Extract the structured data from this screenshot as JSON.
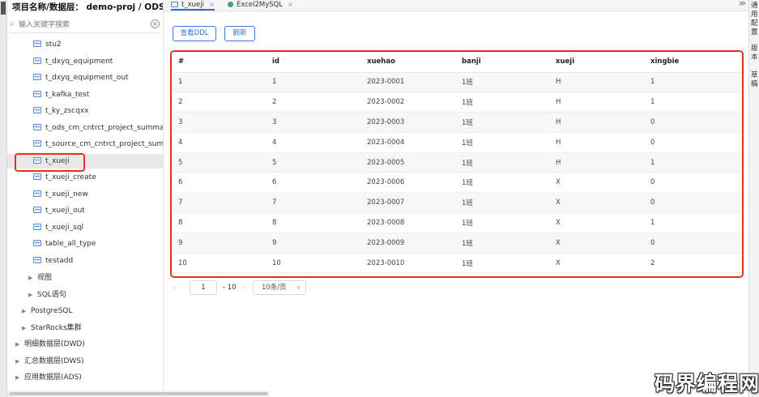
{
  "sidebar": {
    "title": "项目名称/数据层： demo-proj / ODS",
    "search_placeholder": "输入关键字搜索",
    "tables": [
      {
        "label": "stu2",
        "name": "table-item-stu2"
      },
      {
        "label": "t_dxyq_equipment",
        "name": "table-item-t-dxyq-equipment"
      },
      {
        "label": "t_dxyq_equipment_out",
        "name": "table-item-t-dxyq-equipment-out"
      },
      {
        "label": "t_kafka_test",
        "name": "table-item-t-kafka-test"
      },
      {
        "label": "t_ky_zscqxx",
        "name": "table-item-t-ky-zscqxx"
      },
      {
        "label": "t_ods_cm_cntrct_project_summary",
        "name": "table-item-t-ods-cm-cntrct-project-summary"
      },
      {
        "label": "t_source_cm_cntrct_project_summary",
        "name": "table-item-t-source-cm-cntrct-project-summary"
      },
      {
        "label": "t_xueji",
        "name": "table-item-t-xueji"
      },
      {
        "label": "t_xueji_create",
        "name": "table-item-t-xueji-create"
      },
      {
        "label": "t_xueji_new",
        "name": "table-item-t-xueji-new"
      },
      {
        "label": "t_xueji_out",
        "name": "table-item-t-xueji-out"
      },
      {
        "label": "t_xueji_sql",
        "name": "table-item-t-xueji-sql"
      },
      {
        "label": "table_all_type",
        "name": "table-item-table-all-type"
      },
      {
        "label": "testadd",
        "name": "table-item-testadd"
      }
    ],
    "folders": [
      {
        "label": "视图",
        "name": "folder-views"
      },
      {
        "label": "SQL语句",
        "name": "folder-sql"
      },
      {
        "label": "PostgreSQL",
        "name": "folder-postgresql"
      },
      {
        "label": "StarRocks集群",
        "name": "folder-starrocks"
      },
      {
        "label": "明细数据层(DWD)",
        "name": "folder-dwd"
      },
      {
        "label": "汇总数据层(DWS)",
        "name": "folder-dws"
      },
      {
        "label": "应用数据层(ADS)",
        "name": "folder-ads"
      }
    ]
  },
  "tabs": [
    {
      "label": "t_xueji",
      "close": "×"
    },
    {
      "label": "Excel2MySQL",
      "close": "×"
    }
  ],
  "tab_more": "≫",
  "toolbar": {
    "ddl_label": "查看DDL",
    "refresh_label": "刷新"
  },
  "grid": {
    "columns": [
      "#",
      "id",
      "xuehao",
      "banji",
      "xueji",
      "xingbie"
    ],
    "rows": [
      [
        "1",
        "1",
        "2023-0001",
        "1班",
        "H",
        "1"
      ],
      [
        "2",
        "2",
        "2023-0002",
        "1班",
        "H",
        "1"
      ],
      [
        "3",
        "3",
        "2023-0003",
        "1班",
        "H",
        "0"
      ],
      [
        "4",
        "4",
        "2023-0004",
        "1班",
        "H",
        "0"
      ],
      [
        "5",
        "5",
        "2023-0005",
        "1班",
        "H",
        "1"
      ],
      [
        "6",
        "6",
        "2023-0006",
        "1班",
        "X",
        "0"
      ],
      [
        "7",
        "7",
        "2023-0007",
        "1班",
        "X",
        "0"
      ],
      [
        "8",
        "8",
        "2023-0008",
        "1班",
        "X",
        "1"
      ],
      [
        "9",
        "9",
        "2023-0009",
        "1班",
        "X",
        "0"
      ],
      [
        "10",
        "10",
        "2023-0010",
        "1班",
        "X",
        "2"
      ]
    ]
  },
  "pager": {
    "prev": "‹",
    "page": "1",
    "total": "- 10",
    "next": "›",
    "page_size": "10条/页"
  },
  "right_panel": {
    "text_1": "通用配置",
    "text_2": "版本",
    "text_3": "草稿"
  },
  "watermark": "码界编程网"
}
